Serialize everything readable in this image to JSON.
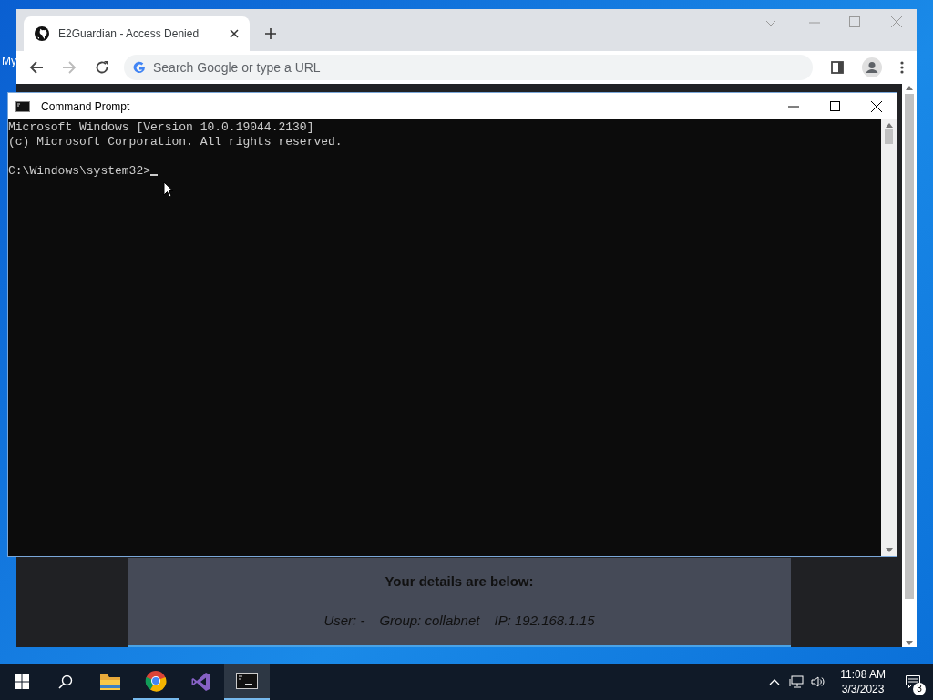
{
  "desktop": {
    "icon_label": "My"
  },
  "browser": {
    "tab": {
      "title": "E2Guardian - Access Denied"
    },
    "address_bar": {
      "placeholder": "Search Google or type a URL"
    },
    "page": {
      "heading": "Your details are below:",
      "details": [
        "User: -",
        "Group: collabnet",
        "IP: 192.168.1.15"
      ]
    }
  },
  "console": {
    "title": "Command Prompt",
    "lines": [
      "Microsoft Windows [Version 10.0.19044.2130]",
      "(c) Microsoft Corporation. All rights reserved."
    ],
    "prompt": "C:\\Windows\\system32>"
  },
  "taskbar": {
    "apps": [
      {
        "kind": "folder",
        "selected": false,
        "running": false
      },
      {
        "kind": "chrome",
        "selected": false,
        "running": true
      },
      {
        "kind": "vs",
        "selected": false,
        "running": false
      },
      {
        "kind": "terminal",
        "selected": true,
        "running": true
      }
    ],
    "time": "11:08 AM",
    "date": "3/3/2023",
    "notifications": "3"
  }
}
